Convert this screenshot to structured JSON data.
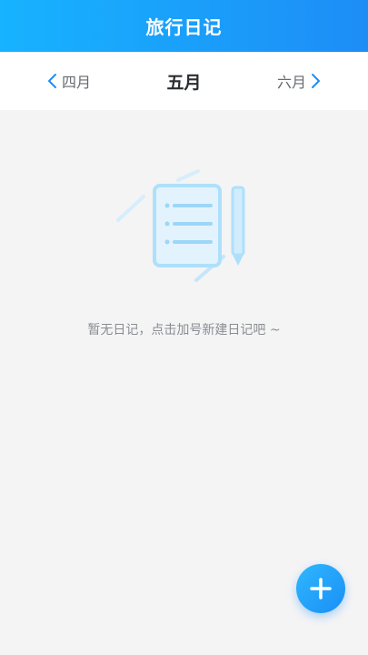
{
  "header": {
    "title": "旅行日记"
  },
  "month_nav": {
    "prev_label": "四月",
    "current_label": "五月",
    "next_label": "六月"
  },
  "empty_state": {
    "message": "暂无日记，点击加号新建日记吧 ~",
    "illustration": "notebook-pen-icon"
  },
  "fab": {
    "icon": "plus-icon"
  },
  "colors": {
    "header_start": "#17b3ff",
    "header_end": "#1d8df6",
    "accent": "#1d8df6",
    "background": "#f4f4f5",
    "illustration": "#aee0fb"
  }
}
